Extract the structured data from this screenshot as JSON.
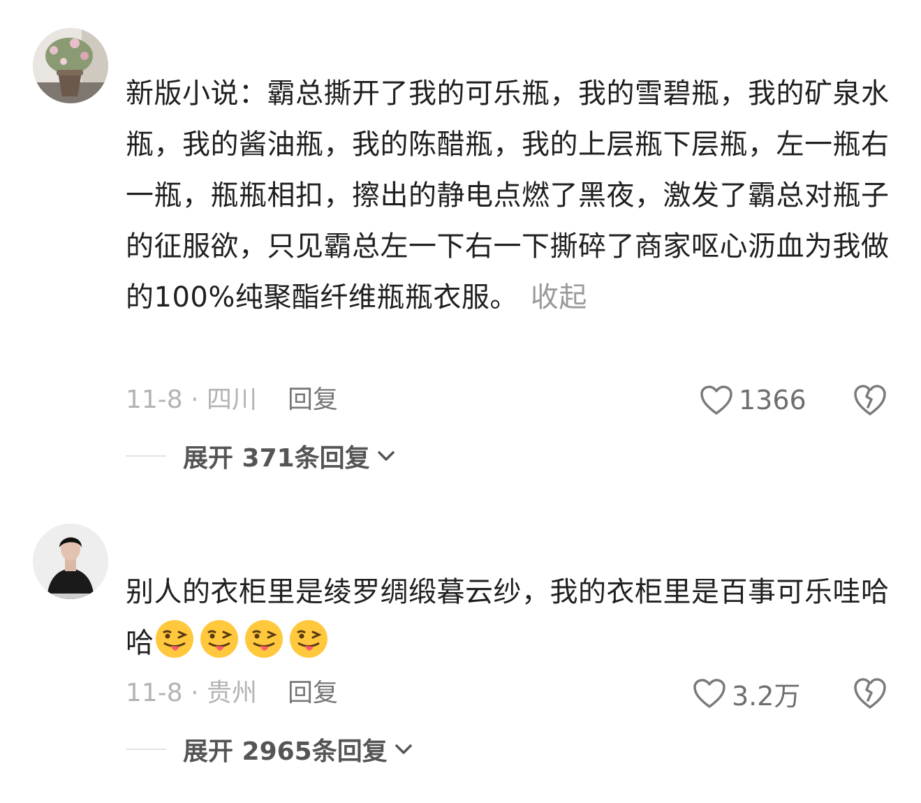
{
  "comments": [
    {
      "text": "新版小说：霸总撕开了我的可乐瓶，我的雪碧瓶，我的矿泉水瓶，我的酱油瓶，我的陈醋瓶，我的上层瓶下层瓶，左一瓶右一瓶，瓶瓶相扣，擦出的静电点燃了黑夜，激发了霸总对瓶子的征服欲，只见霸总左一下右一下撕碎了商家呕心沥血为我做的100%纯聚酯纤维瓶瓶衣服。",
      "collapse_label": "收起",
      "date_location": "11-8 · 四川",
      "reply_label": "回复",
      "likes": "1366",
      "expand_label": "展开 371条回复"
    },
    {
      "text": "别人的衣柜里是绫罗绸缎暮云纱，我的衣柜里是百事可乐哇哈哈",
      "emojis": [
        "tongue-wink-emoji",
        "tongue-wink-emoji",
        "tongue-wink-emoji",
        "tongue-wink-emoji"
      ],
      "date_location": "11-8 · 贵州",
      "reply_label": "回复",
      "likes": "3.2万",
      "expand_label": "展开 2965条回复"
    }
  ],
  "colors": {
    "text": "#1f1f1f",
    "muted": "#b3b3b3",
    "reply": "#777777",
    "expand": "#555555"
  }
}
